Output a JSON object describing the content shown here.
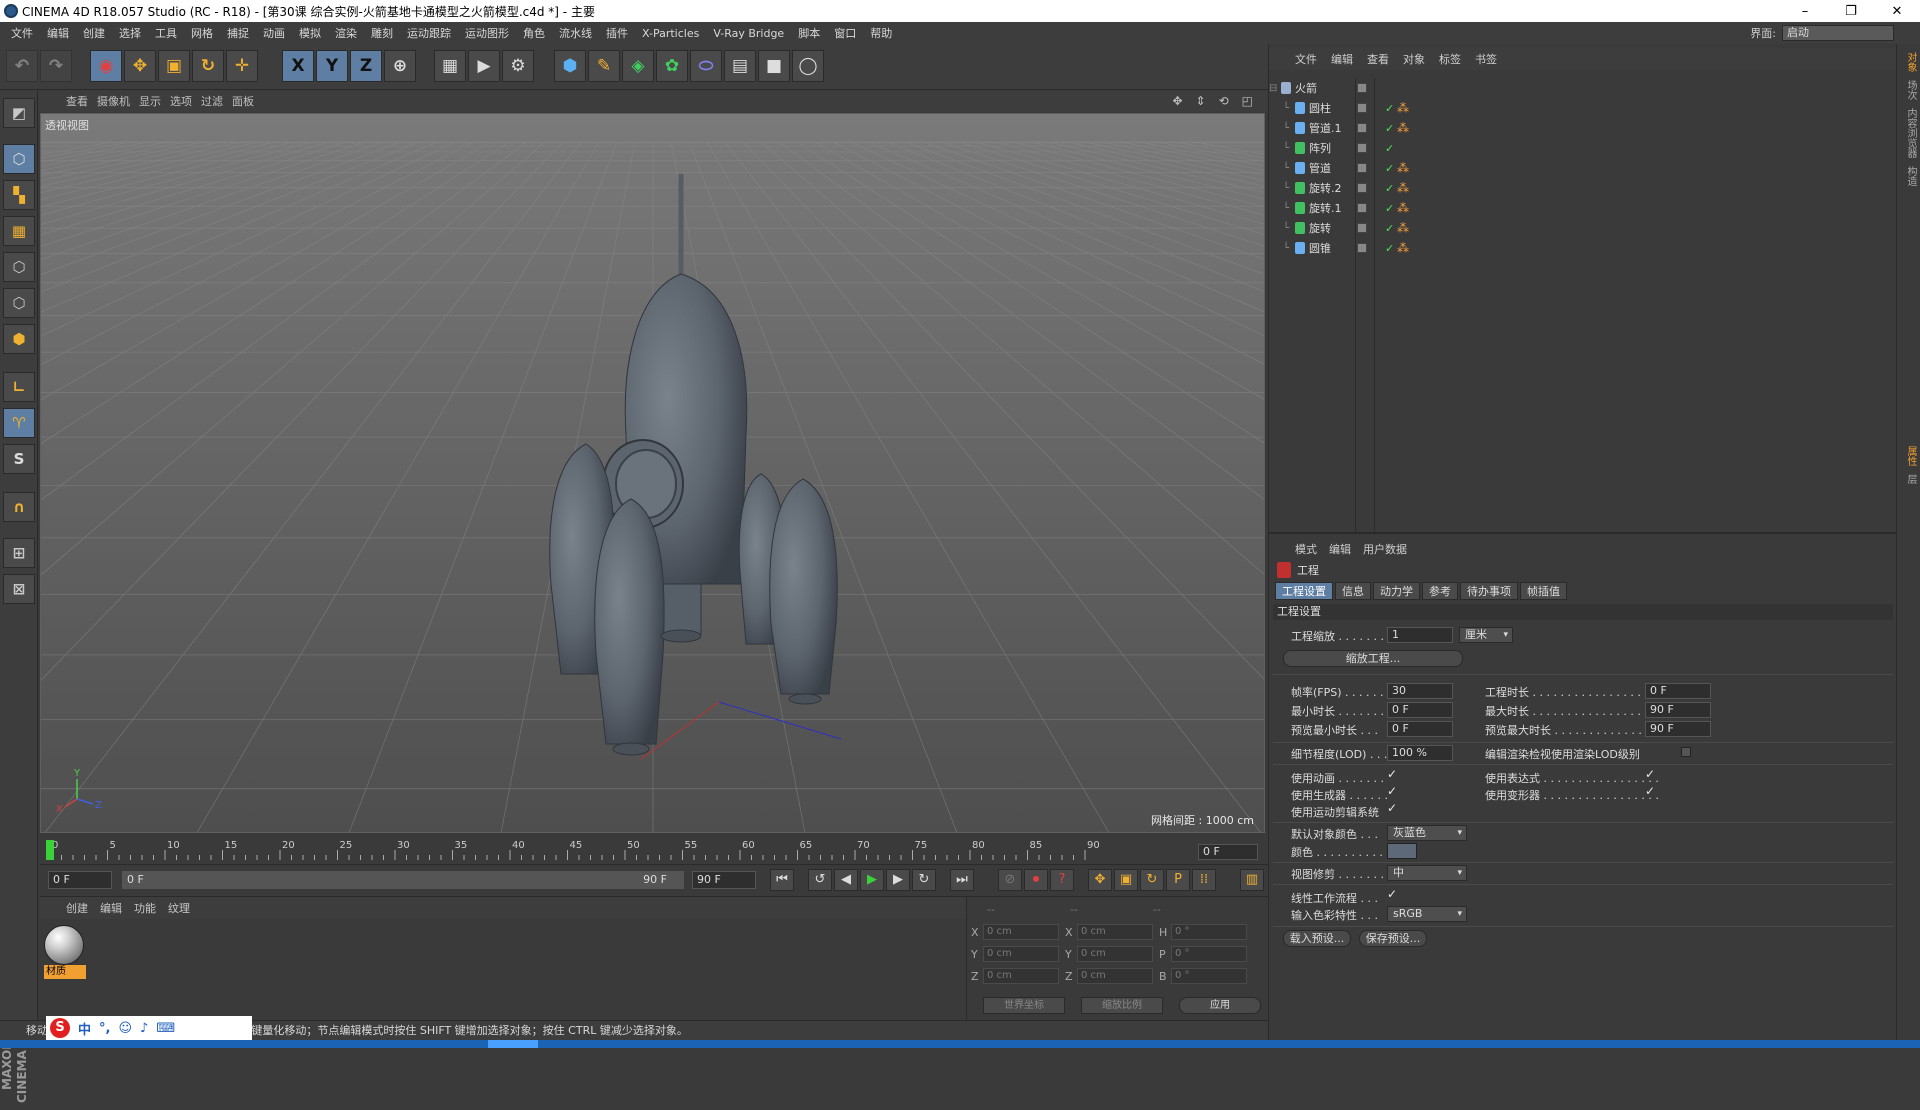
{
  "window": {
    "title": "CINEMA 4D R18.057 Studio (RC - R18) - [第30课  综合实例-火箭基地卡通模型之火箭模型.c4d *] - 主要",
    "minimize": "–",
    "maximize": "❐",
    "close": "✕"
  },
  "menubar": [
    "文件",
    "编辑",
    "创建",
    "选择",
    "工具",
    "网格",
    "捕捉",
    "动画",
    "模拟",
    "渲染",
    "雕刻",
    "运动跟踪",
    "运动图形",
    "角色",
    "流水线",
    "插件",
    "X-Particles",
    "V-Ray Bridge",
    "脚本",
    "窗口",
    "帮助"
  ],
  "interface": {
    "label": "界面:",
    "value": "启动"
  },
  "toolbar": {
    "x": "X",
    "y": "Y",
    "z": "Z"
  },
  "lefttools": {
    "s_label": "S"
  },
  "viewport": {
    "menu": [
      "查看",
      "摄像机",
      "显示",
      "选项",
      "过滤",
      "面板"
    ],
    "label": "透视视图",
    "grid_spacing": "网格间距 : 1000 cm"
  },
  "timeline": {
    "ticks": [
      "0",
      "5",
      "10",
      "15",
      "20",
      "25",
      "30",
      "35",
      "40",
      "45",
      "50",
      "55",
      "60",
      "65",
      "70",
      "75",
      "80",
      "85",
      "90"
    ],
    "current_frame": "0 F",
    "start": "0 F",
    "range_start": "0 F",
    "range_end": "90 F",
    "end": "90 F"
  },
  "materials": {
    "menu": [
      "创建",
      "编辑",
      "功能",
      "纹理"
    ],
    "items": [
      "材质"
    ]
  },
  "coords": {
    "headers": [
      "--",
      "--",
      "--"
    ],
    "rows": [
      {
        "a": "X",
        "av": "0 cm",
        "b": "X",
        "bv": "0 cm",
        "c": "H",
        "cv": "0 °"
      },
      {
        "a": "Y",
        "av": "0 cm",
        "b": "Y",
        "bv": "0 cm",
        "c": "P",
        "cv": "0 °"
      },
      {
        "a": "Z",
        "av": "0 cm",
        "b": "Z",
        "bv": "0 cm",
        "c": "B",
        "cv": "0 °"
      }
    ],
    "world": "世界坐标",
    "scale": "缩放比例",
    "apply": "应用"
  },
  "statusbar": {
    "text": "移动：点击并拖动鼠标移动元素。按住 SHIFT 键量化移动；节点编辑模式时按住 SHIFT 键增加选择对象；按住 CTRL 键减少选择对象。"
  },
  "ime": {
    "logo": "S",
    "lang": "中",
    "punct": "°,",
    "emoji": "☺",
    "mic": "♪",
    "kb": "⌨"
  },
  "objects": {
    "menu": [
      "文件",
      "编辑",
      "查看",
      "对象",
      "标签",
      "书签"
    ],
    "items": [
      {
        "name": "火箭",
        "depth": 0,
        "color": "#9ab0d0",
        "check": "",
        "tags": false
      },
      {
        "name": "圆柱",
        "depth": 1,
        "color": "#6ab0f0",
        "check": "✓",
        "tags": true
      },
      {
        "name": "管道.1",
        "depth": 1,
        "color": "#6ab0f0",
        "check": "✓",
        "tags": true
      },
      {
        "name": "阵列",
        "depth": 1,
        "color": "#40c060",
        "check": "✓",
        "tags": false
      },
      {
        "name": "管道",
        "depth": 1,
        "color": "#6ab0f0",
        "check": "✓",
        "tags": true
      },
      {
        "name": "旋转.2",
        "depth": 1,
        "color": "#40c060",
        "check": "✓",
        "tags": true
      },
      {
        "name": "旋转.1",
        "depth": 1,
        "color": "#40c060",
        "check": "✓",
        "tags": true
      },
      {
        "name": "旋转",
        "depth": 1,
        "color": "#40c060",
        "check": "✓",
        "tags": true
      },
      {
        "name": "圆锥",
        "depth": 1,
        "color": "#6ab0f0",
        "check": "✓",
        "tags": true
      }
    ]
  },
  "attributes": {
    "menu": [
      "模式",
      "编辑",
      "用户数据"
    ],
    "object": "工程",
    "tabs": [
      "工程设置",
      "信息",
      "动力学",
      "参考",
      "待办事项",
      "帧插值"
    ],
    "section": "工程设置",
    "scale_label": "工程缩放 . . . . . . .",
    "scale_value": "1",
    "scale_unit": "厘米",
    "scale_btn": "缩放工程...",
    "fps_label": "帧率(FPS) . . . . . .",
    "fps_value": "30",
    "duration_label": "工程时长 . . . . . . . . . . . . . . . . . . .",
    "duration_value": "0 F",
    "min_label": "最小时长 . . . . . . .",
    "min_value": "0 F",
    "max_label": "最大时长 . . . . . . . . . . . . . . . . . . .",
    "max_value": "90 F",
    "pmin_label": "预览最小时长 . . .",
    "pmin_value": "0 F",
    "pmax_label": "预览最大时长 . . . . . . . . . . . . . . .",
    "pmax_value": "90 F",
    "lod_label": "细节程度(LOD) . . .",
    "lod_value": "100 %",
    "lod_render_label": "编辑渲染检视使用渲染LOD级别",
    "anim_label": "使用动画 . . . . . . .",
    "expr_label": "使用表达式 . . . . . . . . . . . . . . . . .",
    "gen_label": "使用生成器 . . . . . .",
    "deform_label": "使用变形器 . . . . . . . . . . . . . . . . .",
    "motion_label": "使用运动剪辑系统",
    "objcolor_label": "默认对象颜色 . . .",
    "objcolor_value": "灰蓝色",
    "color_label": "颜色 . . . . . . . . . . .",
    "clip_label": "视图修剪 . . . . . . .",
    "clip_value": "中",
    "linear_label": "线性工作流程 . . .",
    "profile_label": "输入色彩特性 . . .",
    "profile_value": "sRGB",
    "load_btn": "载入预设...",
    "save_btn": "保存预设...",
    "check": "✓"
  },
  "right_tabs": [
    "对象",
    "场次",
    "内容浏览器",
    "构造",
    "属性",
    "层"
  ],
  "colors": {
    "accent": "#5e7fa3",
    "rocket": "#5c646e",
    "viewport_bg": "#6a6a6a"
  }
}
